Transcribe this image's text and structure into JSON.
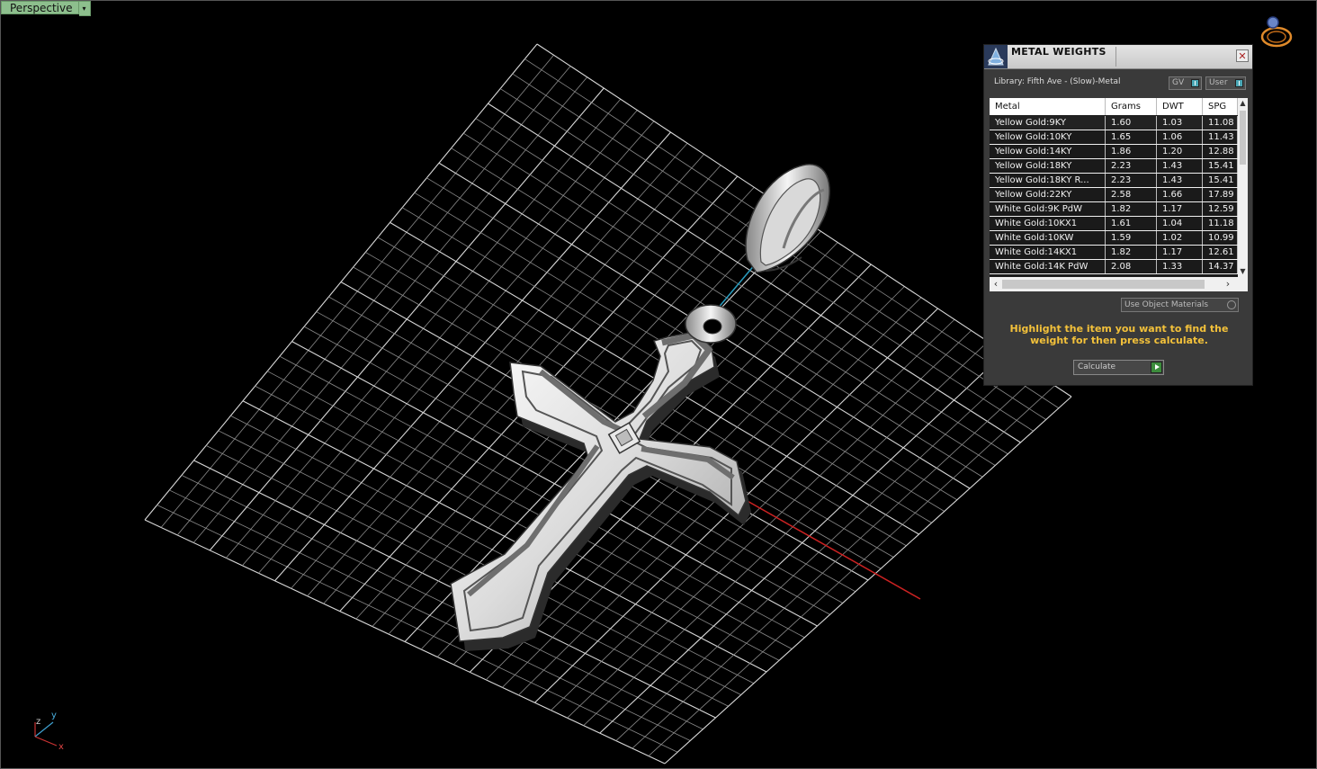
{
  "viewport": {
    "name": "Perspective",
    "dropdown_arrow": "▾",
    "axis_labels": {
      "z": "z",
      "y": "y",
      "x": "x"
    }
  },
  "panel": {
    "title": "METAL WEIGHTS",
    "close_glyph": "✕",
    "library": "Library: Fifth Ave - (Slow)-Metal",
    "toggles": [
      "GV",
      "User"
    ],
    "columns": [
      "Metal",
      "Grams",
      "DWT",
      "SPG"
    ],
    "rows": [
      [
        "Yellow Gold:9KY",
        "1.60",
        "1.03",
        "11.08"
      ],
      [
        "Yellow Gold:10KY",
        "1.65",
        "1.06",
        "11.43"
      ],
      [
        "Yellow Gold:14KY",
        "1.86",
        "1.20",
        "12.88"
      ],
      [
        "Yellow Gold:18KY",
        "2.23",
        "1.43",
        "15.41"
      ],
      [
        "Yellow Gold:18KY R...",
        "2.23",
        "1.43",
        "15.41"
      ],
      [
        "Yellow Gold:22KY",
        "2.58",
        "1.66",
        "17.89"
      ],
      [
        "White Gold:9K PdW",
        "1.82",
        "1.17",
        "12.59"
      ],
      [
        "White Gold:10KX1",
        "1.61",
        "1.04",
        "11.18"
      ],
      [
        "White Gold:10KW",
        "1.59",
        "1.02",
        "10.99"
      ],
      [
        "White Gold:14KX1",
        "1.82",
        "1.17",
        "12.61"
      ],
      [
        "White Gold:14K PdW",
        "2.08",
        "1.33",
        "14.37"
      ]
    ],
    "use_object_materials": "Use Object Materials",
    "hint": "Highlight the item you want to find the weight for then press calculate.",
    "calculate": "Calculate"
  },
  "icons": {
    "navigation": "ring-navigation-icon",
    "axis": "axis-triad-icon",
    "logo": "metal-weights-logo-icon"
  },
  "colors": {
    "label_bg": "#8dbf8d",
    "hint": "#f3c13a",
    "grid": "#cfcfcf",
    "axis_x": "#cc2222",
    "axis_y": "#2a9dc0"
  }
}
